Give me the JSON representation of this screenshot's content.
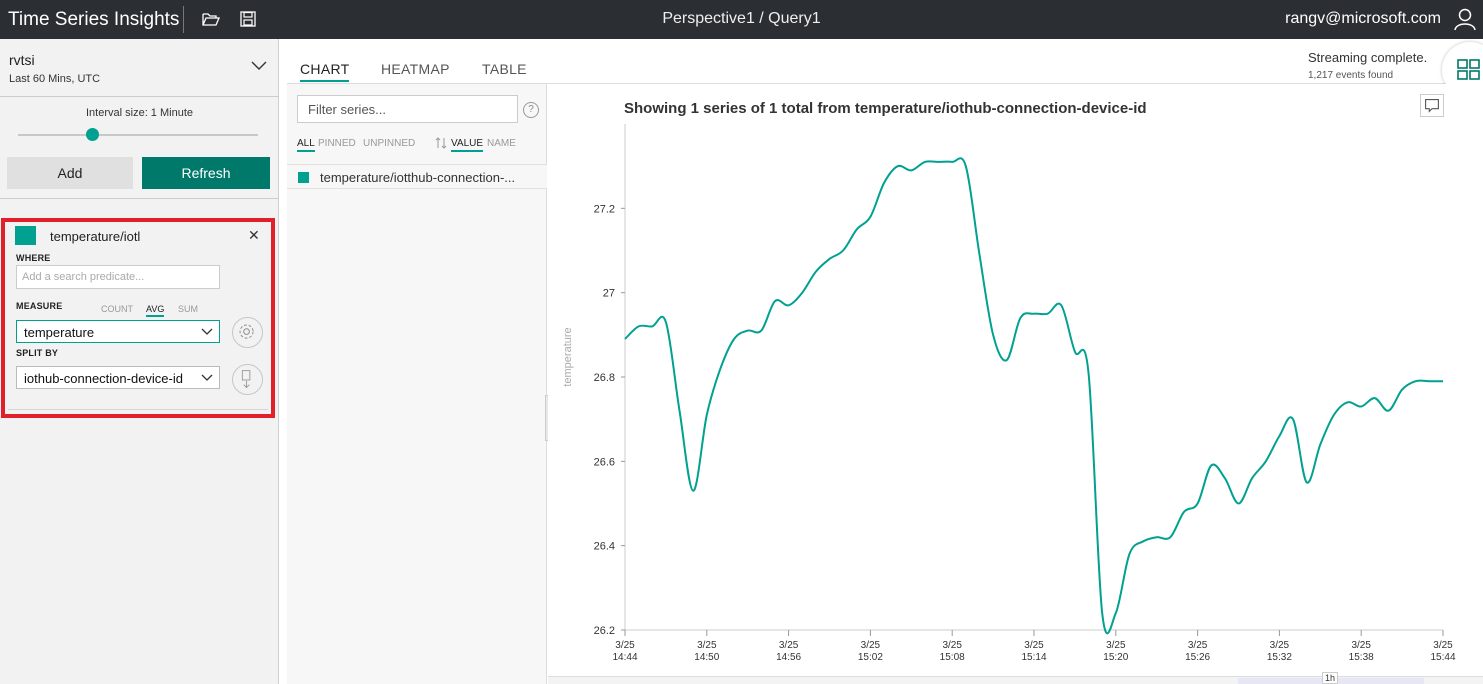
{
  "topbar": {
    "app_title": "Time Series Insights",
    "breadcrumb": "Perspective1 / Query1",
    "user": "rangv@microsoft.com",
    "icons": [
      "folder-open-icon",
      "save-icon",
      "user-icon"
    ]
  },
  "environment": {
    "name": "rvtsi",
    "time_range": "Last 60 Mins, UTC"
  },
  "interval": {
    "label": "Interval size: 1 Minute",
    "level": 0.31
  },
  "actions": {
    "add_label": "Add",
    "refresh_label": "Refresh"
  },
  "query": {
    "name": "temperature/iotl",
    "color": "#00a190",
    "where_label": "WHERE",
    "where_placeholder": "Add a search predicate...",
    "measure_label": "MEASURE",
    "measure_options": [
      "COUNT",
      "AVG",
      "SUM"
    ],
    "measure_selected": "AVG",
    "measure_value": "temperature",
    "split_label": "SPLIT BY",
    "split_value": "iothub-connection-device-id"
  },
  "tabs": [
    "CHART",
    "HEATMAP",
    "TABLE"
  ],
  "active_tab": "CHART",
  "status": {
    "main": "Streaming complete.",
    "sub": "1,217 events found"
  },
  "series_panel": {
    "filter_placeholder": "Filter series...",
    "help": "?",
    "filter_options": [
      "ALL",
      "PINNED",
      "UNPINNED"
    ],
    "sort_options": [
      "VALUE",
      "NAME"
    ],
    "series": [
      {
        "label": "temperature/iotthub-connection-...",
        "color": "#00a190"
      }
    ]
  },
  "brush_label": "1h",
  "chart_data": {
    "type": "line",
    "title": "Showing 1 series of 1 total from temperature/iothub-connection-device-id",
    "ylabel": "temperature",
    "ylim": [
      26.2,
      27.4
    ],
    "yticks": [
      26.2,
      26.4,
      26.6,
      26.8,
      27,
      27.2
    ],
    "x_ticks": [
      {
        "date": "3/25",
        "time": "14:44"
      },
      {
        "date": "3/25",
        "time": "14:50"
      },
      {
        "date": "3/25",
        "time": "14:56"
      },
      {
        "date": "3/25",
        "time": "15:02"
      },
      {
        "date": "3/25",
        "time": "15:08"
      },
      {
        "date": "3/25",
        "time": "15:14"
      },
      {
        "date": "3/25",
        "time": "15:20"
      },
      {
        "date": "3/25",
        "time": "15:26"
      },
      {
        "date": "3/25",
        "time": "15:32"
      },
      {
        "date": "3/25",
        "time": "15:38"
      },
      {
        "date": "3/25",
        "time": "15:44"
      }
    ],
    "x_start": "14:44",
    "x_end": "15:44",
    "series": [
      {
        "color": "#00a190",
        "x": [
          "14:44",
          "14:45",
          "14:46",
          "14:47",
          "14:48",
          "14:49",
          "14:50",
          "14:51",
          "14:52",
          "14:53",
          "14:54",
          "14:55",
          "14:56",
          "14:57",
          "14:58",
          "14:59",
          "15:00",
          "15:01",
          "15:02",
          "15:03",
          "15:04",
          "15:05",
          "15:06",
          "15:07",
          "15:08",
          "15:09",
          "15:10",
          "15:11",
          "15:12",
          "15:13",
          "15:14",
          "15:15",
          "15:16",
          "15:17",
          "15:18",
          "15:19",
          "15:20",
          "15:21",
          "15:22",
          "15:23",
          "15:24",
          "15:25",
          "15:26",
          "15:27",
          "15:28",
          "15:29",
          "15:30",
          "15:31",
          "15:32",
          "15:33",
          "15:34",
          "15:35",
          "15:36",
          "15:37",
          "15:38",
          "15:39",
          "15:40",
          "15:41",
          "15:42",
          "15:43",
          "15:44"
        ],
        "values": [
          26.89,
          26.92,
          26.92,
          26.93,
          26.72,
          26.53,
          26.71,
          26.82,
          26.89,
          26.91,
          26.91,
          26.98,
          26.97,
          27.0,
          27.05,
          27.08,
          27.1,
          27.15,
          27.18,
          27.26,
          27.3,
          27.29,
          27.31,
          27.31,
          27.31,
          27.3,
          27.09,
          26.9,
          26.84,
          26.94,
          26.95,
          26.95,
          26.97,
          26.86,
          26.81,
          26.24,
          26.24,
          26.38,
          26.41,
          26.42,
          26.42,
          26.48,
          26.5,
          26.59,
          26.56,
          26.5,
          26.56,
          26.6,
          26.66,
          26.7,
          26.55,
          26.64,
          26.71,
          26.74,
          26.73,
          26.75,
          26.72,
          26.77,
          26.79,
          26.79,
          26.79
        ]
      }
    ]
  }
}
